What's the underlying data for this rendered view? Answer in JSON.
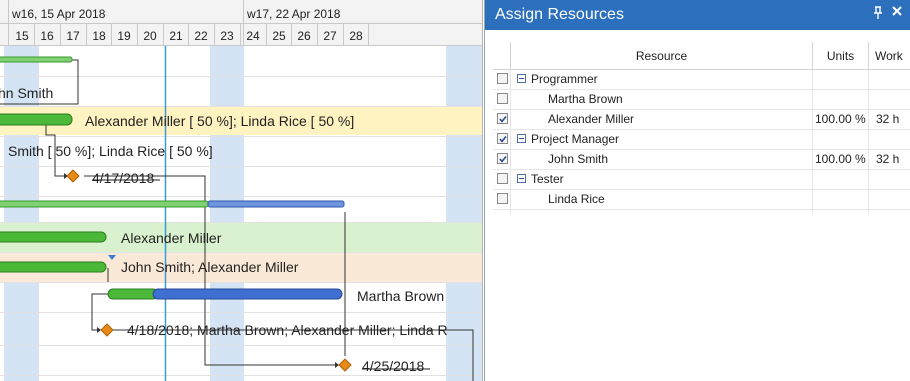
{
  "gantt": {
    "weeks": [
      {
        "label": "w16, 15 Apr 2018"
      },
      {
        "label": "w17, 22 Apr 2018"
      }
    ],
    "days": [
      "15",
      "16",
      "17",
      "18",
      "19",
      "20",
      "21",
      "22",
      "23",
      "24",
      "25",
      "26",
      "27",
      "28"
    ],
    "rows": [
      {
        "label": ""
      },
      {
        "label": "hn Smith"
      },
      {
        "label": "Alexander Miller [ 50 %]; Linda Rice [ 50 %]"
      },
      {
        "label": "Smith [ 50 %]; Linda Rice [ 50 %]"
      },
      {
        "label": "4/17/2018"
      },
      {
        "label": ""
      },
      {
        "label": "Alexander Miller"
      },
      {
        "label": "John Smith; Alexander Miller"
      },
      {
        "label": "Martha Brown"
      },
      {
        "label": "4/18/2018; Martha Brown; Alexander Miller; Linda R"
      },
      {
        "label": "4/25/2018"
      }
    ],
    "colors": {
      "weekend": "#d5e4f4",
      "today_line": "#3a9ad9",
      "bar_green": "#4cb83a",
      "bar_blue": "#3f6fd0",
      "milestone": "#e88a17",
      "highlight_yellow": "#fff3c2",
      "highlight_green": "#d9f1cf",
      "highlight_peach": "#fbe9d8"
    }
  },
  "panel": {
    "title": "Assign Resources",
    "pin_icon": "pin-icon",
    "close_icon": "close-icon",
    "columns": [
      "Resource",
      "Units",
      "Work"
    ],
    "rows": [
      {
        "checked": false,
        "group": true,
        "resource": "Programmer",
        "units": "",
        "work": ""
      },
      {
        "checked": false,
        "group": false,
        "resource": "Martha Brown",
        "units": "",
        "work": ""
      },
      {
        "checked": true,
        "group": false,
        "resource": "Alexander Miller",
        "units": "100.00 %",
        "work": "32 h"
      },
      {
        "checked": true,
        "group": true,
        "resource": "Project Manager",
        "units": "",
        "work": ""
      },
      {
        "checked": true,
        "group": false,
        "resource": "John Smith",
        "units": "100.00 %",
        "work": "32 h"
      },
      {
        "checked": false,
        "group": true,
        "resource": "Tester",
        "units": "",
        "work": ""
      },
      {
        "checked": false,
        "group": false,
        "resource": "Linda Rice",
        "units": "",
        "work": ""
      }
    ],
    "accent": "#2c6fbd"
  }
}
